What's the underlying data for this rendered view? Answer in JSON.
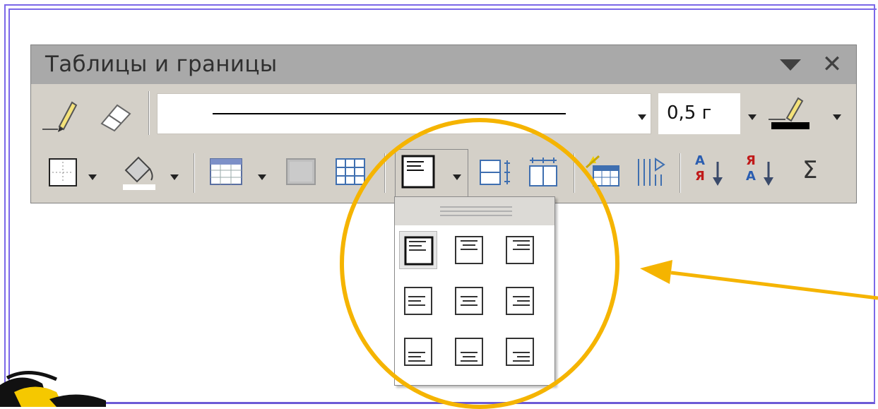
{
  "window": {
    "title": "Таблицы и границы",
    "close_glyph": "✕"
  },
  "row1": {
    "line_width_value": "0,5 г",
    "icons": [
      "pencil-icon",
      "eraser-icon",
      "line-style-dropdown",
      "line-width-dropdown",
      "border-color-icon"
    ]
  },
  "row2": {
    "icons": [
      "outside-border-icon",
      "shading-color-icon",
      "insert-table-icon",
      "merge-cells-icon",
      "split-cells-icon",
      "align-top-left-icon",
      "distribute-rows-icon",
      "distribute-columns-icon",
      "table-autoformat-icon",
      "text-direction-icon",
      "sort-ascending-icon",
      "sort-descending-icon",
      "autosum-icon"
    ],
    "sum_glyph": "Σ",
    "sort_asc_top": "А",
    "sort_asc_bottom": "Я",
    "sort_desc_top": "Я",
    "sort_desc_bottom": "А"
  },
  "align_menu": {
    "rows": [
      [
        "top-left",
        "top-center",
        "top-right"
      ],
      [
        "middle-left",
        "middle-center",
        "middle-right"
      ],
      [
        "bottom-left",
        "bottom-center",
        "bottom-right"
      ]
    ],
    "selected": "top-left"
  },
  "colors": {
    "frame": "#7b68e8",
    "highlight": "#f5b400",
    "toolbar_bg": "#d4d0c8",
    "titlebar_bg": "#a9a9a9"
  }
}
